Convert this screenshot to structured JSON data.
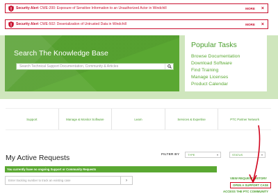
{
  "alerts": [
    {
      "label": "Security Alert",
      "message": "CWE-200: Exposure of Sensitive Information to an Unauthorized Actor in Windchill",
      "more": "MORE",
      "close": "×"
    },
    {
      "label": "Security Alert",
      "message": "CWE-502: Deserialization of Untrusted Data in Windchill",
      "more": "MORE",
      "close": "×"
    }
  ],
  "knowledge_base": {
    "title": "Search The Knowledge Base",
    "search_placeholder": "Search Technical Support Documentation, Community & Articles"
  },
  "popular_tasks": {
    "title": "Popular Tasks",
    "items": [
      "Browse Documentation",
      "Download Software",
      "Find Training",
      "Manage Licenses",
      "Product Calendar"
    ]
  },
  "nav": {
    "items": [
      "Support",
      "Manage & Monitor Software",
      "Learn",
      "Services & Expertise",
      "PTC Partner Network"
    ]
  },
  "requests": {
    "title": "My Active Requests",
    "filter_label": "FILTER BY",
    "type_value": "TYPE",
    "status_value": "STATUS",
    "banner": "You currently have no ongoing Support or Community Requests",
    "tracking_placeholder": "Enter tracking number to track an existing case",
    "go": "›",
    "view_history": "VIEW REQUEST HISTORY",
    "open_case": "OPEN A SUPPORT CASE",
    "access_community": "ACCESS THE PTC COMMUNITY"
  },
  "colors": {
    "alert_red": "#c8102e",
    "brand_green": "#5aa832",
    "hero_bg": "#cfe6bd",
    "annotation_red": "#d0021b"
  },
  "icons": {
    "alert": "shield-icon",
    "search": "search-icon",
    "go": "chevron-right-icon"
  }
}
